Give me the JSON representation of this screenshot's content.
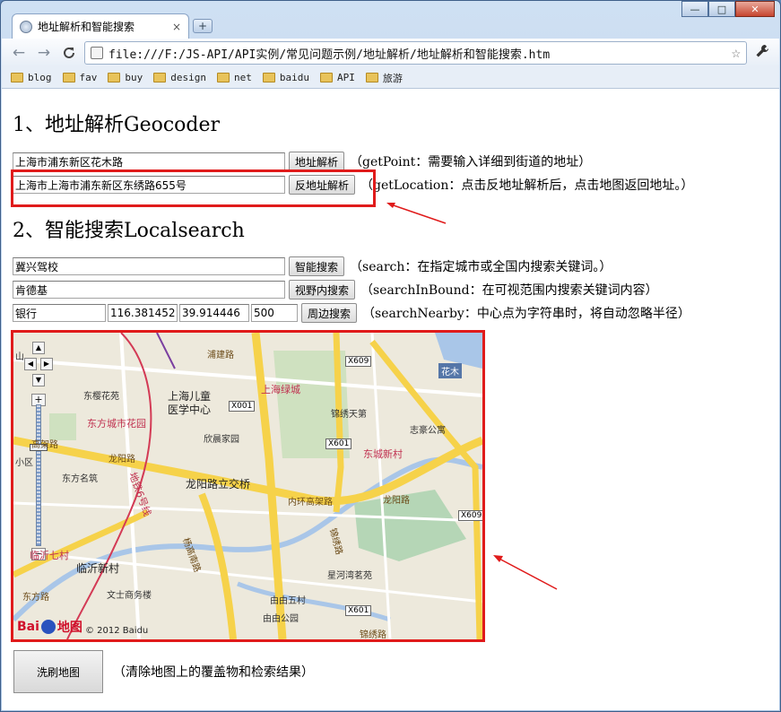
{
  "window": {
    "minimize": "—",
    "maximize": "□",
    "close": "✕"
  },
  "tab": {
    "title": "地址解析和智能搜索",
    "close": "×",
    "new_tab": "+"
  },
  "toolbar": {
    "back": "←",
    "forward": "→",
    "reload": "C",
    "url": "file:///F:/JS-API/API实例/常见问题示例/地址解析/地址解析和智能搜索.htm",
    "star": "☆",
    "wrench": "🔧"
  },
  "bookmarks": [
    {
      "label": "blog"
    },
    {
      "label": "fav"
    },
    {
      "label": "buy"
    },
    {
      "label": "design"
    },
    {
      "label": "net"
    },
    {
      "label": "baidu"
    },
    {
      "label": "API"
    },
    {
      "label": "旅游"
    }
  ],
  "section1": {
    "heading": "1、地址解析Geocoder",
    "geocode": {
      "value": "上海市浦东新区花木路",
      "button": "地址解析",
      "note": "（getPoint：需要输入详细到街道的地址）"
    },
    "reverse": {
      "value": "上海市上海市浦东新区东绣路655号",
      "button": "反地址解析",
      "note": "（getLocation：点击反地址解析后，点击地图返回地址。）"
    }
  },
  "section2": {
    "heading": "2、智能搜索Localsearch",
    "search": {
      "value": "冀兴驾校",
      "button": "智能搜索",
      "note": "（search：在指定城市或全国内搜索关键词。）"
    },
    "in_bounds": {
      "value": "肯德基",
      "button": "视野内搜索",
      "note": "（searchInBound：在可视范围内搜索关键词内容）"
    },
    "nearby": {
      "keyword": "银行",
      "lng": "116.381452",
      "lat": "39.914446",
      "radius": "500",
      "button": "周边搜索",
      "note": "（searchNearby：中心点为字符串时，将自动忽略半径）"
    }
  },
  "map": {
    "labels": {
      "huamu": "花木",
      "pujian": "浦建路",
      "dongying": "东樱花苑",
      "children1": "上海儿童",
      "children2": "医学中心",
      "shanghai_green": "上海绿城",
      "jincheng": "锦绣天第",
      "zhihao": "志豪公寓",
      "dongfang_city": "东方城市花园",
      "xinchen": "欣晨家园",
      "dongcheng": "东城新村",
      "gaoke": "高架路",
      "longyang_rd": "龙阳路",
      "dongfang_mingzhu": "东方名筑",
      "interchange": "龙阳路立交桥",
      "metro6": "地铁6号线",
      "neihuan": "内环高架路",
      "longyang_rd2": "龙阳路",
      "yanggao": "杨高南路",
      "jinxiu": "锦绣路",
      "linyi7": "临沂七村",
      "linyi": "临沂新村",
      "xinghe": "星河湾茗苑",
      "wenshi": "文士商务楼",
      "youyou5": "由由五村",
      "youyou_park": "由由公园",
      "jinxiu_rd": "锦绣路",
      "dongfang_rd": "东方路",
      "xiaoqu": "小区",
      "shan": "山"
    },
    "shields": {
      "x609_a": "X609",
      "x001": "X001",
      "x601_a": "X601",
      "x609_b": "X609",
      "x601_b": "X601"
    },
    "logo_text": "Bai",
    "logo_suffix": "地图",
    "copyright": "© 2012 Baidu"
  },
  "clear": {
    "button": "洗刷地图",
    "note": "（清除地图上的覆盖物和检索结果）"
  },
  "colors": {
    "highlight_red": "#e01b1b",
    "road_yellow": "#f6d24a",
    "water_blue": "#a9c6e8"
  }
}
